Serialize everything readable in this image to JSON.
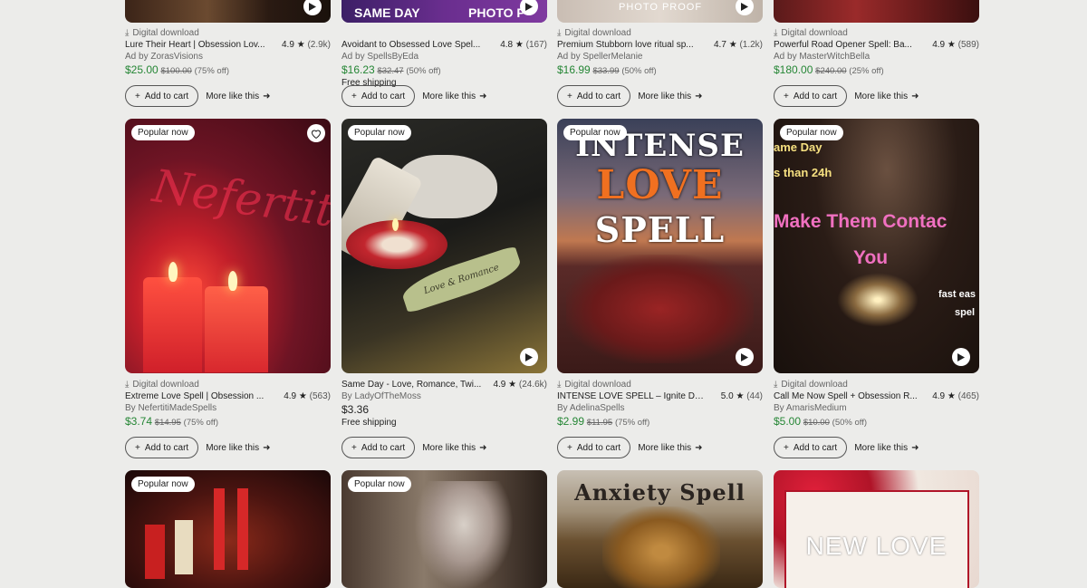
{
  "ui": {
    "digital_download": "Digital download",
    "add_to_cart": "Add to cart",
    "more_like_this": "More like this",
    "popular_now": "Popular now",
    "free_shipping": "Free shipping",
    "sale_color": "#258635"
  },
  "row1": [
    {
      "title": "Lure Their Heart | Obsession Lov...",
      "rating": "4.9",
      "count": "(2.9k)",
      "by": "Ad by ZorasVisions",
      "price": "$25.00",
      "orig": "$100.00",
      "off": "(75% off)",
      "top_text": ""
    },
    {
      "title": "Avoidant to Obsessed Love Spel...",
      "rating": "4.8",
      "count": "(167)",
      "by": "Ad by SpellsByEda",
      "price": "$16.23",
      "orig": "$32.47",
      "off": "(50% off)",
      "shipping": "Free shipping",
      "top_text": "SAME DAY",
      "top_text2": "PHOTO P"
    },
    {
      "title": "Premium Stubborn love ritual sp...",
      "rating": "4.7",
      "count": "(1.2k)",
      "by": "Ad by SpellerMelanie",
      "price": "$16.99",
      "orig": "$33.99",
      "off": "(50% off)",
      "top_text": "PHOTO PROOF"
    },
    {
      "title": "Powerful Road Opener Spell: Ba...",
      "rating": "4.9",
      "count": "(589)",
      "by": "Ad by MasterWitchBella",
      "price": "$180.00",
      "orig": "$240.00",
      "off": "(25% off)",
      "top_text": ""
    }
  ],
  "row2": [
    {
      "title": "Extreme Love Spell | Obsession ...",
      "rating": "4.9",
      "count": "(563)",
      "by": "By NefertitiMadeSpells",
      "price": "$3.74",
      "orig": "$14.95",
      "off": "(75% off)",
      "digital": true,
      "script_text": "Nefertiti"
    },
    {
      "title": "Same Day - Love, Romance, Twi...",
      "rating": "4.9",
      "count": "(24.6k)",
      "by": "By LadyOfTheMoss",
      "price": "$3.36",
      "shipping": "Free shipping",
      "digital": false,
      "leaf_text": "Love & Romance"
    },
    {
      "title": "INTENSE LOVE SPELL – Ignite De...",
      "rating": "5.0",
      "count": "(44)",
      "by": "By AdelinaSpells",
      "price": "$2.99",
      "orig": "$11.95",
      "off": "(75% off)",
      "digital": true,
      "lines": [
        "INTENSE",
        "LOVE",
        "SPELL"
      ]
    },
    {
      "title": "Call Me Now Spell + Obsession R...",
      "rating": "4.9",
      "count": "(465)",
      "by": "By AmarisMedium",
      "price": "$5.00",
      "orig": "$10.00",
      "off": "(50% off)",
      "digital": true,
      "lines": [
        "ame Day",
        "s than 24h",
        "Make Them Contac",
        "You",
        "fast eas",
        "spel"
      ]
    }
  ],
  "row3": [
    {
      "badge": "Popular now",
      "text": ""
    },
    {
      "badge": "Popular now",
      "text": ""
    },
    {
      "badge": "",
      "text": "Anxiety Spell"
    },
    {
      "badge": "",
      "text": "NEW LOVE"
    }
  ]
}
